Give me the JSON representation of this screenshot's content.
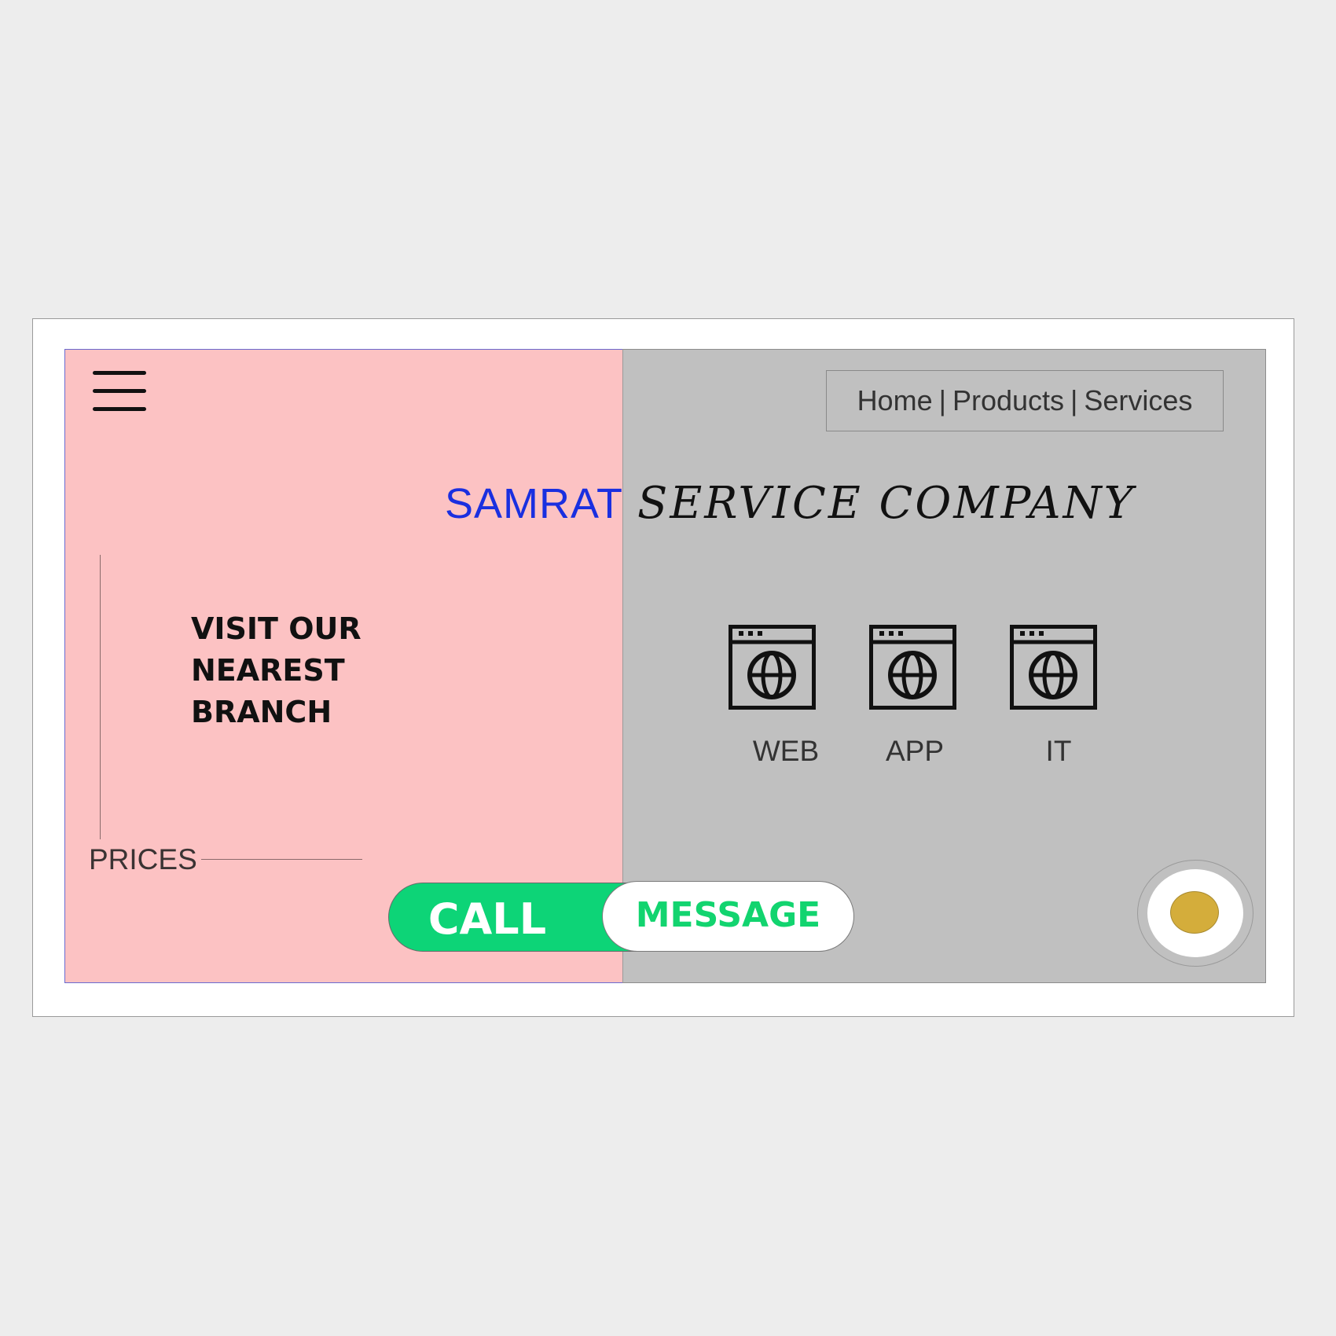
{
  "nav": {
    "home": "Home",
    "separator": "|",
    "products": "Products",
    "services": "Services"
  },
  "header": {
    "brand": "SAMRAT",
    "tagline": "SERVICE COMPANY"
  },
  "promo": {
    "line1": "VISIT OUR",
    "line2": "NEAREST",
    "line3": "BRANCH"
  },
  "prices_label": "PRICES",
  "services": [
    {
      "label": "WEB",
      "icon": "web-browser-globe-icon"
    },
    {
      "label": "APP",
      "icon": "web-browser-globe-icon"
    },
    {
      "label": "IT",
      "icon": "web-browser-globe-icon"
    }
  ],
  "actions": {
    "call_label": "CALL",
    "message_label": "MESSAGE"
  },
  "colors": {
    "left_panel": "#fcc2c3",
    "right_panel": "#c0c0c0",
    "brand_blue": "#1a2fe0",
    "call_green": "#0dd477",
    "record_dot": "#d4ad3b"
  }
}
